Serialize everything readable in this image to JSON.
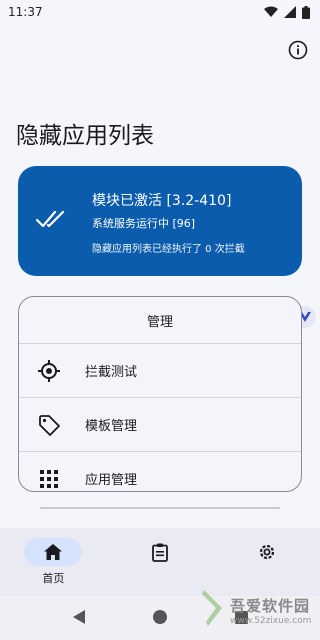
{
  "status": {
    "time": "11:37"
  },
  "title": "隐藏应用列表",
  "module": {
    "title": "模块已激活 [3.2-410]",
    "service": "系统服务运行中 [96]",
    "note": "隐藏应用列表已经执行了 0 次拦截",
    "color": "#0b5cad"
  },
  "manage": {
    "header": "管理",
    "items": [
      {
        "label": "拦截测试",
        "icon": "target-icon"
      },
      {
        "label": "模板管理",
        "icon": "tag-icon"
      },
      {
        "label": "应用管理",
        "icon": "apps-grid-icon"
      }
    ]
  },
  "bottom_nav": {
    "items": [
      {
        "label": "首页",
        "icon": "home-icon",
        "active": true
      },
      {
        "label": "",
        "icon": "clipboard-icon",
        "active": false
      },
      {
        "label": "",
        "icon": "settings-icon",
        "active": false
      }
    ]
  },
  "watermark": {
    "text": "吾爱软件园",
    "url": "www.52zixue.com"
  }
}
